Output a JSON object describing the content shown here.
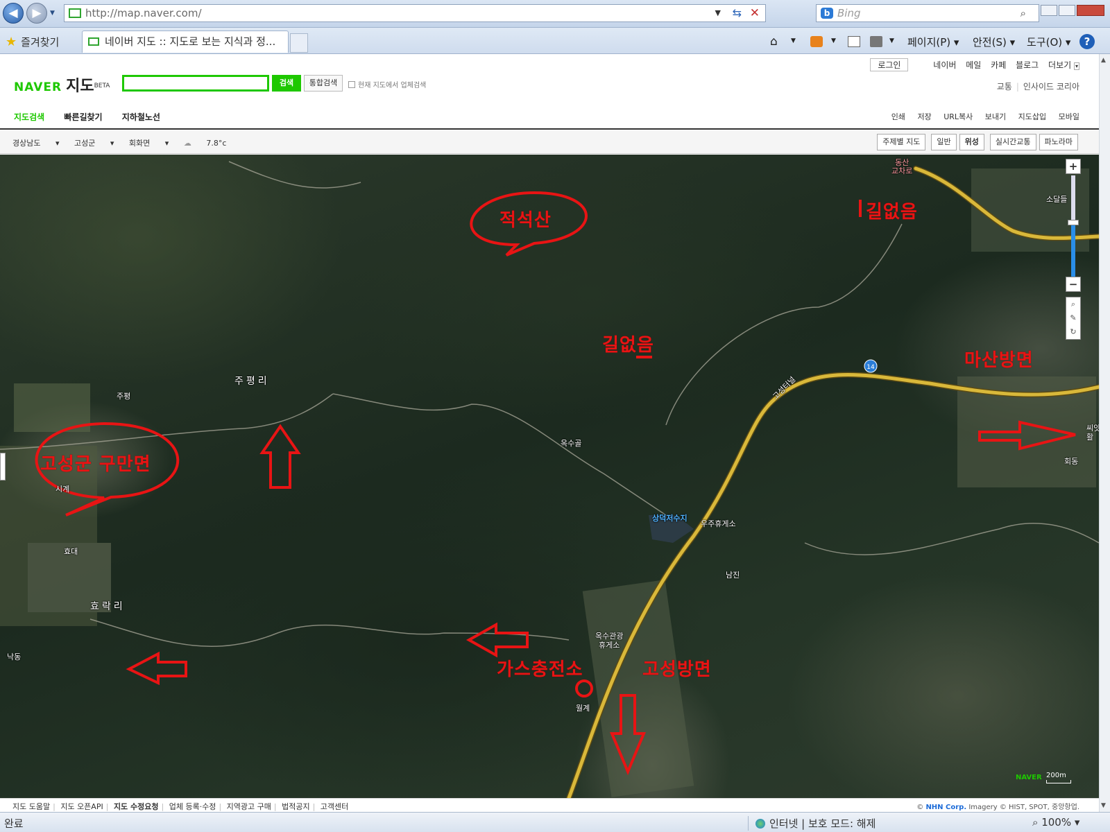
{
  "browser": {
    "address": "http://map.naver.com/",
    "search_placeholder": "Bing",
    "favorites_label": "즐겨찾기",
    "tab_title": "네이버 지도 :: 지도로 보는 지식과 정...",
    "tools": {
      "page": "페이지(P)",
      "safety": "안전(S)",
      "tools": "도구(O)"
    },
    "status": {
      "left": "완료",
      "zone": "인터넷 | 보호 모드: 해제",
      "zoom": "100%"
    }
  },
  "naver": {
    "util": {
      "login": "로그인",
      "links": [
        "네이버",
        "메일",
        "카페",
        "블로그",
        "더보기"
      ]
    },
    "logo": {
      "brand": "NAVER",
      "service": "지도",
      "beta": "BETA"
    },
    "search": {
      "button": "검색",
      "all_button": "통합검색",
      "in_map": "현재 지도에서 업체검색"
    },
    "right_links": [
      "교통",
      "인사이드 코리아"
    ],
    "menu": [
      "지도검색",
      "빠른길찾기",
      "지하철노선"
    ],
    "right_menu": [
      "인쇄",
      "저장",
      "URL복사",
      "보내기",
      "지도삽입",
      "모바일"
    ]
  },
  "location": {
    "breadcrumbs": [
      "경상남도",
      "고성군",
      "회화면"
    ],
    "weather": "7.8°c",
    "map_types": [
      "주제별 지도",
      "일반",
      "위성",
      "실시간교통",
      "파노라마"
    ],
    "active_type": "위성"
  },
  "map": {
    "places": {
      "dongsan": "동산\n교차로",
      "sodaldeul": "소달들",
      "jupyeong_village": "주평",
      "jupyeong_ri": "주평리",
      "oksugol": "옥수골",
      "sangdeok": "상덕저수지",
      "uju": "우주휴게소",
      "namjin": "남진",
      "okcheon": "옥수관광\n휴게소",
      "wolgye": "월계",
      "hoedong": "회동",
      "ssiap": "씨앗\n활",
      "sigye": "시계",
      "hyodae": "효대",
      "hyorak": "효락리",
      "nakdong": "낙동",
      "route": "14",
      "tunnel": "고성터널"
    },
    "annotations": {
      "jeokseoksan": "적석산",
      "noroad1": "길없음",
      "noroad2": "길없음",
      "masan": "마산방면",
      "guman": "고성군 구만면",
      "gas": "가스충전소",
      "goseong": "고성방면"
    },
    "zoom_level": 0.56,
    "scale": "200m",
    "watermark": "NAVER"
  },
  "footer": {
    "links": [
      "지도 도움말",
      "지도 오픈API",
      "지도 수정요청",
      "업체 등록·수정",
      "지역광고 구매",
      "법적공지",
      "고객센터"
    ],
    "copyright_prefix": "©",
    "copyright_corp": "NHN Corp.",
    "copyright_rest": "Imagery © HIST, SPOT, 중앙항업."
  },
  "colors": {
    "naver_green": "#1ec800",
    "annotation_red": "#e81414",
    "highway": "#d9b83a"
  }
}
